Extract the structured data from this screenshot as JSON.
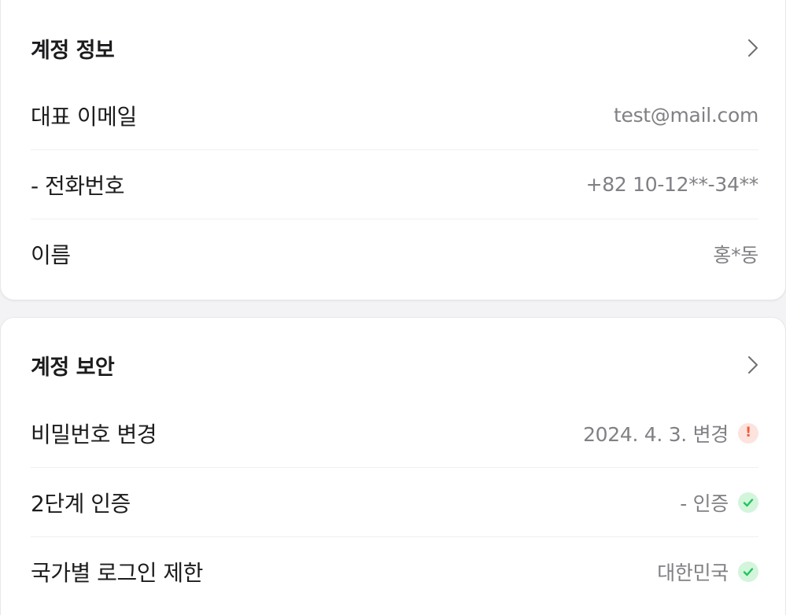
{
  "account_info": {
    "title": "계정 정보",
    "rows": [
      {
        "label": "대표 이메일",
        "value": "test@mail.com"
      },
      {
        "label": "- 전화번호",
        "value": "+82 10-12**-34**"
      },
      {
        "label": "이름",
        "value": "홍*동"
      }
    ]
  },
  "account_security": {
    "title": "계정 보안",
    "rows": [
      {
        "label": "비밀번호 변경",
        "value": "2024. 4. 3. 변경",
        "status_icon": "warning-icon",
        "status_color": "#f05a3b"
      },
      {
        "label": "2단계 인증",
        "value": "- 인증",
        "status_icon": "check-icon",
        "status_color": "#22c55e"
      },
      {
        "label": "국가별 로그인 제한",
        "value": "대한민국",
        "status_icon": "check-icon",
        "status_color": "#22c55e"
      }
    ]
  },
  "icons": {
    "chevron": "chevron-right-icon"
  }
}
